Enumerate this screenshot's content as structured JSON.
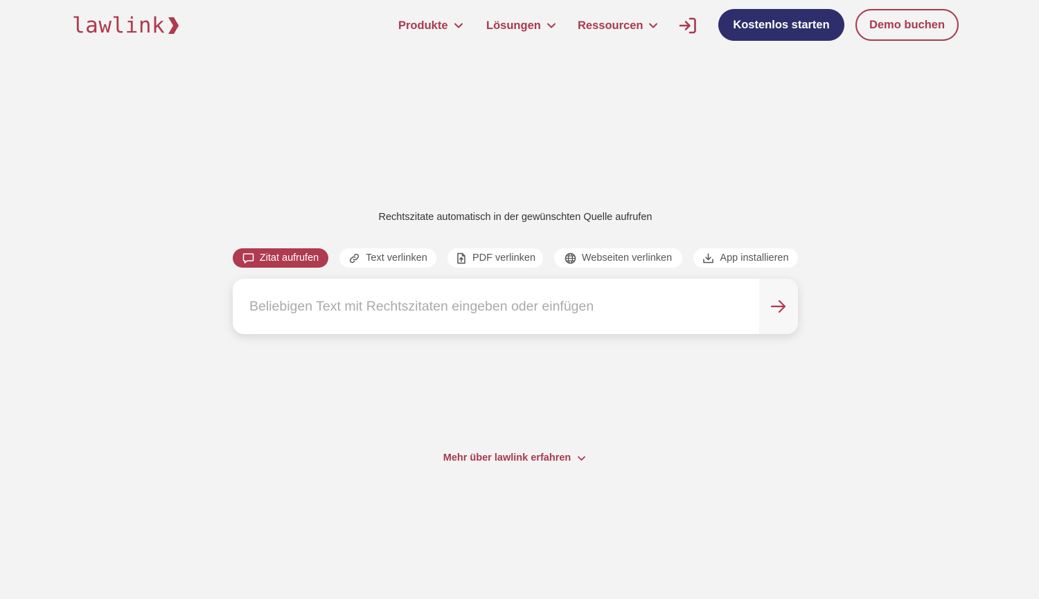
{
  "brand": {
    "logo_text": "lawlink",
    "primary_color": "#b03a4f",
    "navy_color": "#2d2e6b",
    "logo_icon": "chevron-right-icon"
  },
  "nav": {
    "items": [
      {
        "label": "Produkte",
        "icon": "chevron-down-icon"
      },
      {
        "label": "Lösungen",
        "icon": "chevron-down-icon"
      },
      {
        "label": "Ressourcen",
        "icon": "chevron-down-icon"
      }
    ],
    "login_icon": "login-icon",
    "cta_primary": "Kostenlos starten",
    "cta_secondary": "Demo buchen"
  },
  "hero": {
    "tagline": "Rechtszitate automatisch in der gewünschten Quelle aufrufen",
    "tabs": [
      {
        "label": "Zitat aufrufen",
        "icon": "speech-bubble-icon",
        "active": true
      },
      {
        "label": "Text verlinken",
        "icon": "link-icon",
        "active": false
      },
      {
        "label": "PDF verlinken",
        "icon": "file-upload-icon",
        "active": false
      },
      {
        "label": "Webseiten verlinken",
        "icon": "globe-icon",
        "active": false
      },
      {
        "label": "App installieren",
        "icon": "download-icon",
        "active": false
      }
    ],
    "search": {
      "placeholder": "Beliebigen Text mit Rechtszitaten eingeben oder einfügen",
      "value": "",
      "submit_icon": "arrow-right-icon"
    }
  },
  "footer_link": {
    "label": "Mehr über lawlink erfahren",
    "icon": "chevron-down-icon"
  }
}
